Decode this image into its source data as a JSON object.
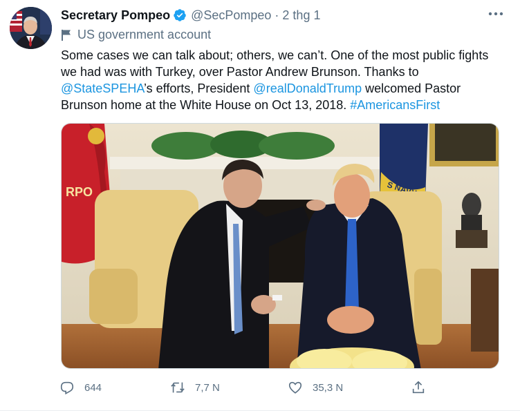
{
  "author": {
    "name": "Secretary Pompeo",
    "handle": "@SecPompeo",
    "separator": "·",
    "time": "2 thg 1",
    "label": "US government account"
  },
  "tweet": {
    "parts": [
      {
        "text": "Some cases we can talk about; others, we can’t. One of the most public fights we had was with Turkey, over Pastor Andrew Brunson. Thanks to ",
        "link": false
      },
      {
        "text": "@StateSPEHA",
        "link": true
      },
      {
        "text": "’s efforts, President ",
        "link": false
      },
      {
        "text": "@realDonaldTrump",
        "link": true
      },
      {
        "text": " welcomed Pastor Brunson home at the White House on Oct 13, 2018. ",
        "link": false
      },
      {
        "text": "#AmericansFirst",
        "link": true
      }
    ]
  },
  "photo": {
    "flag_text": "RPO",
    "navy_text": "S NAVY"
  },
  "actions": {
    "reply_count": "644",
    "retweet_count": "7,7 N",
    "like_count": "35,3 N"
  },
  "icons": {
    "verified": "verified-badge-icon",
    "more": "more-icon",
    "gov": "flag-icon",
    "reply": "reply-icon",
    "retweet": "retweet-icon",
    "like": "heart-icon",
    "share": "share-icon"
  },
  "colors": {
    "link": "#1b95e0",
    "secondary_text": "#5b7083",
    "verified": "#1da1f2"
  }
}
